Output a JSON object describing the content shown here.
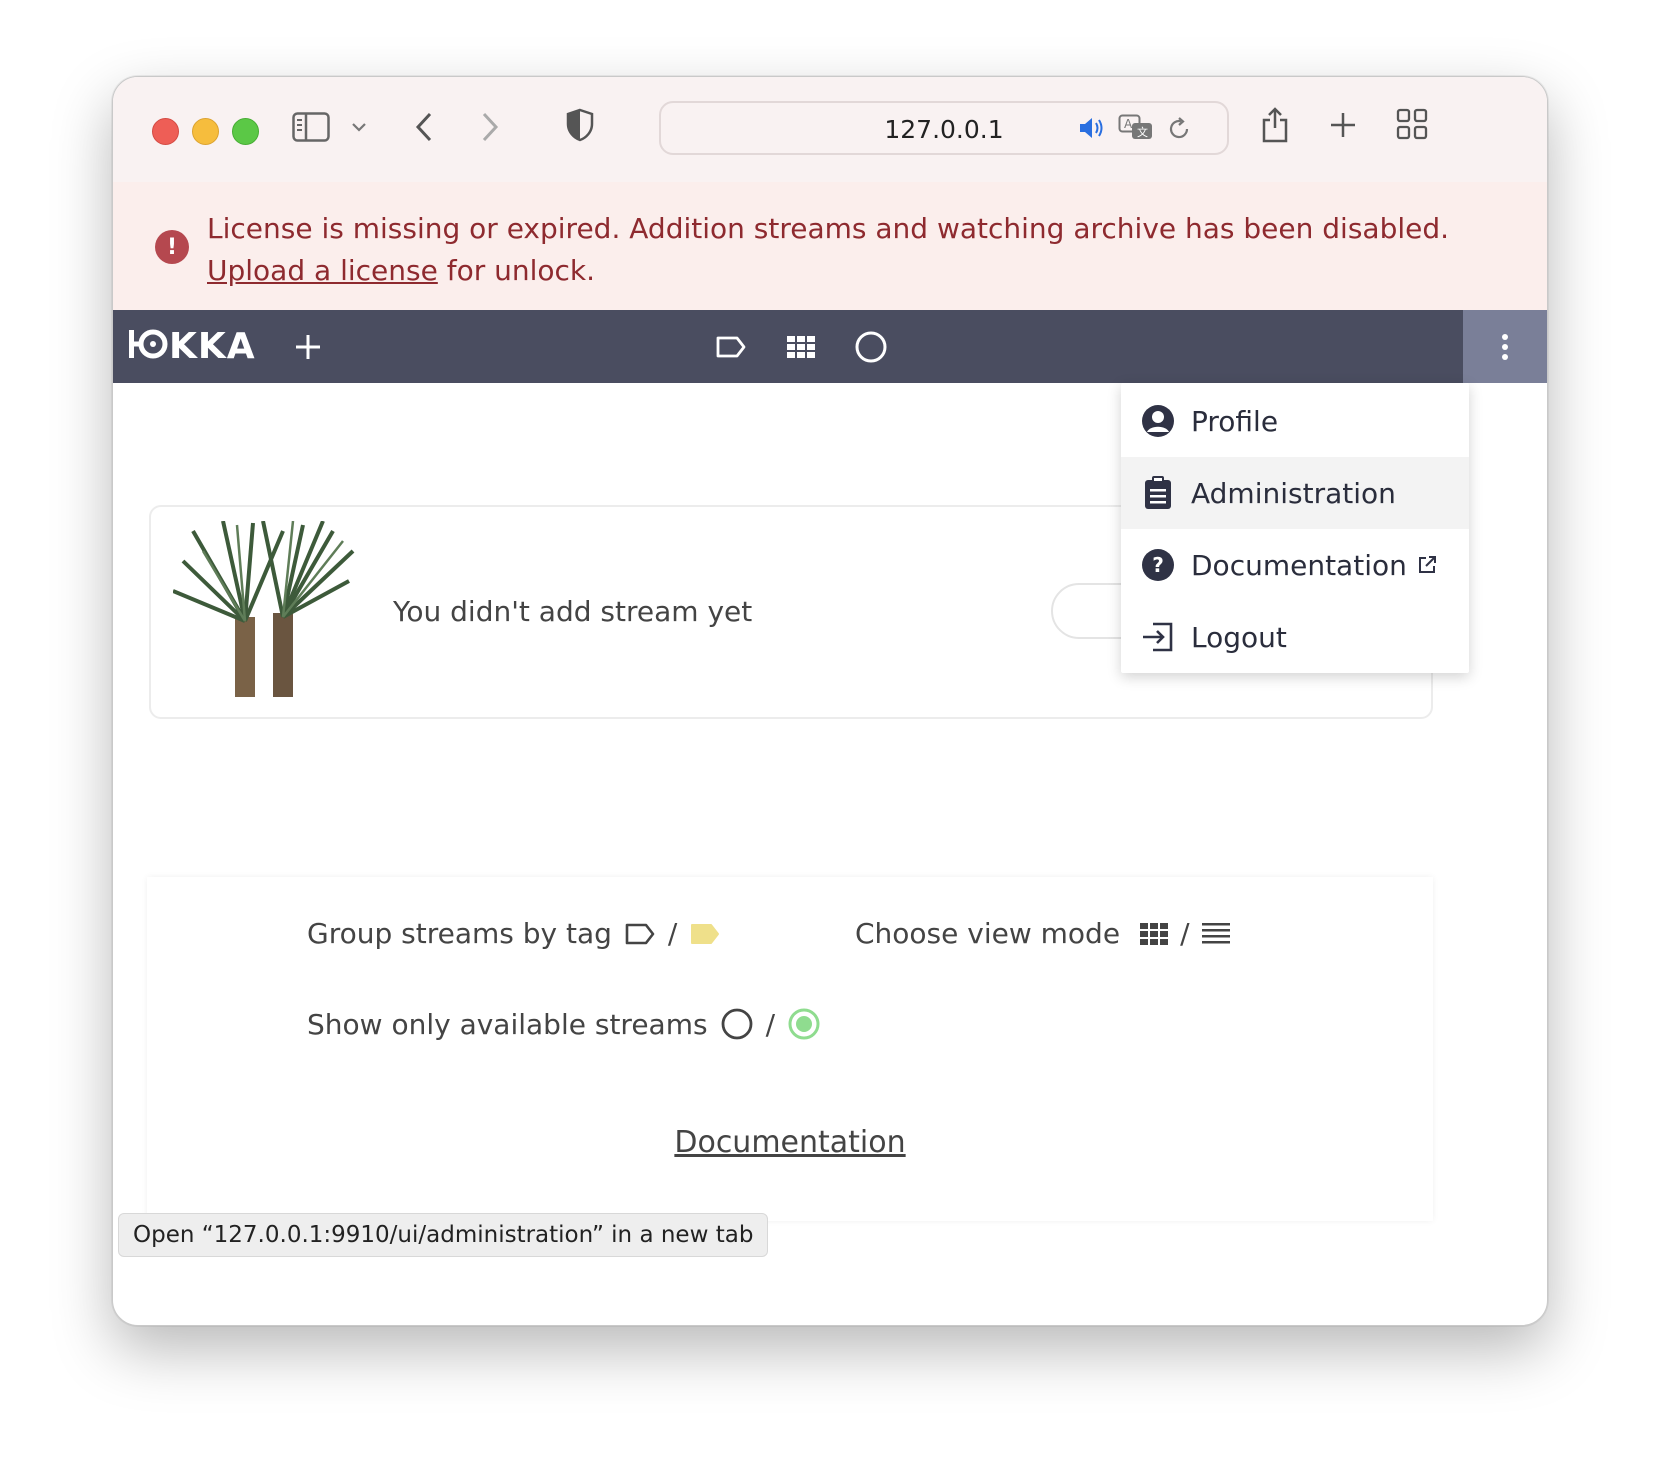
{
  "browser": {
    "url": "127.0.0.1"
  },
  "banner": {
    "message": "License is missing or expired. Addition streams and watching archive has been disabled.",
    "link_text": "Upload a license",
    "suffix": " for unlock."
  },
  "app": {
    "logo_text": "ꟷOKKA"
  },
  "menu": {
    "items": [
      {
        "label": "Profile",
        "icon": "user-circle-icon"
      },
      {
        "label": "Administration",
        "icon": "clipboard-icon"
      },
      {
        "label": "Documentation",
        "icon": "question-circle-icon"
      },
      {
        "label": "Logout",
        "icon": "logout-icon"
      }
    ]
  },
  "streams": {
    "empty_text": "You didn't add stream yet"
  },
  "settings": {
    "group_by_tag": "Group streams by tag",
    "view_mode": "Choose view mode",
    "available_only": "Show only available streams",
    "slash": "/",
    "documentation_link": "Documentation",
    "colors": {
      "tag_active": "#efe08a",
      "available_active": "#8fdc8f"
    }
  },
  "status_bar": {
    "text": "Open “127.0.0.1:9910/ui/administration” in a new tab"
  }
}
